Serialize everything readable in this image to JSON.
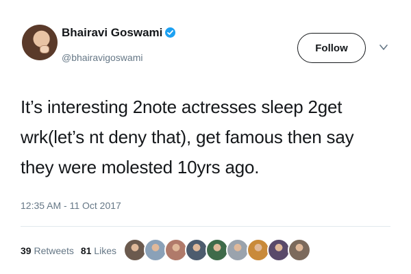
{
  "author": {
    "name": "Bhairavi Goswami",
    "handle": "@bhairavigoswami",
    "verified_icon": "verified-badge-icon",
    "verified_color": "#1da1f2"
  },
  "actions": {
    "follow_label": "Follow",
    "menu_icon": "chevron-down-icon"
  },
  "tweet": {
    "lines": [
      "It’s interesting 2note actresses sleep 2get",
      "wrk(let’s nt deny that), get famous then say",
      "they were molested 10yrs ago."
    ],
    "timestamp": "12:35 AM - 11 Oct 2017"
  },
  "stats": {
    "retweets_count": "39",
    "retweets_label": "Retweets",
    "likes_count": "81",
    "likes_label": "Likes"
  },
  "likers": [
    {
      "color": "#6b5a4e"
    },
    {
      "color": "#8aa1b8"
    },
    {
      "color": "#b07a6a"
    },
    {
      "color": "#4d5c6e"
    },
    {
      "color": "#3f6b4a"
    },
    {
      "color": "#9aa3ad"
    },
    {
      "color": "#c98a3a"
    },
    {
      "color": "#5a4a6a"
    },
    {
      "color": "#7c6a5c"
    }
  ],
  "colors": {
    "text": "#14171a",
    "secondary": "#657786",
    "divider": "#e1e8ed"
  }
}
